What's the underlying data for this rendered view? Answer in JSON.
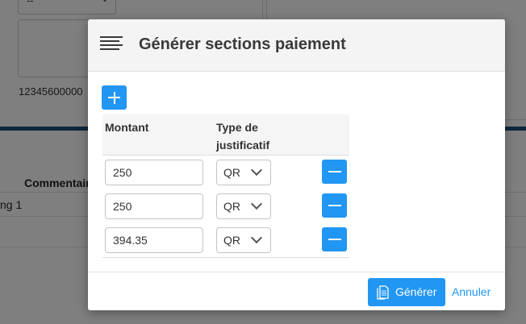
{
  "background": {
    "select_value": "--",
    "number_text": "12345600000",
    "table_header": "Commentaire",
    "table_cell": "ng 1"
  },
  "modal": {
    "title": "Générer sections paiement",
    "icons": {
      "menu": "menu-lines-icon",
      "add": "plus-icon",
      "remove": "minus-icon",
      "generate": "document-icon",
      "dropdown": "chevron-down-icon"
    },
    "columns": {
      "amount": "Montant",
      "type": "Type de justificatif"
    },
    "rows": [
      {
        "amount": "250",
        "type": "QR"
      },
      {
        "amount": "250",
        "type": "QR"
      },
      {
        "amount": "394.35",
        "type": "QR"
      }
    ],
    "footer": {
      "generate_label": "Générer",
      "cancel_label": "Annuler"
    }
  },
  "colors": {
    "accent": "#2196f3",
    "header_bg": "#f4f4f4",
    "title": "#3a3a3a"
  }
}
